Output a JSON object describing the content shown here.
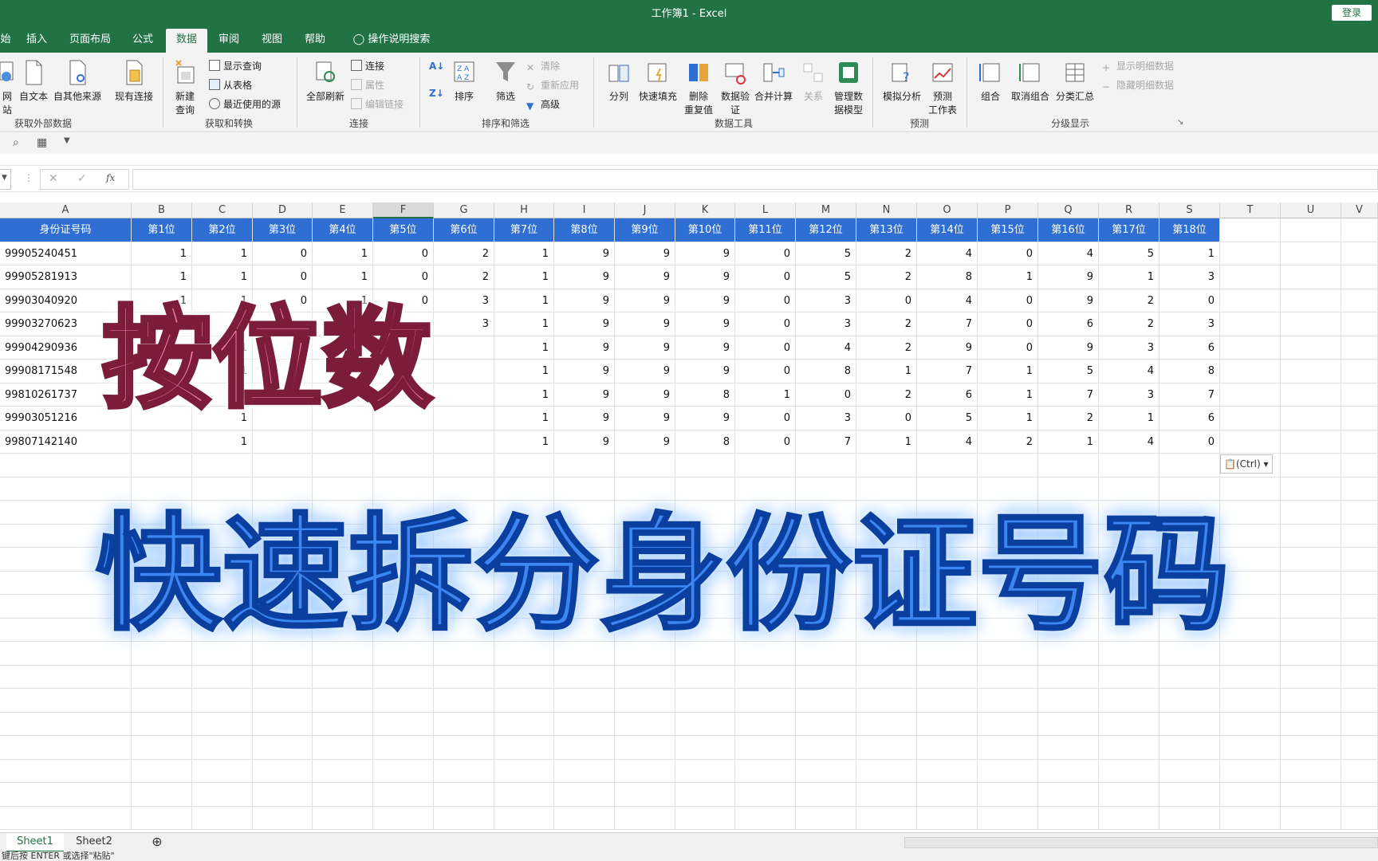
{
  "window": {
    "title": "工作簿1  -  Excel",
    "login_label": "登录"
  },
  "tabs": [
    {
      "label": "始"
    },
    {
      "label": "插入"
    },
    {
      "label": "页面布局"
    },
    {
      "label": "公式"
    },
    {
      "label": "数据",
      "active": true
    },
    {
      "label": "审阅"
    },
    {
      "label": "视图"
    },
    {
      "label": "帮助"
    },
    {
      "label": "操作说明搜索"
    }
  ],
  "ribbon": {
    "groups": {
      "get_external": "获取外部数据",
      "get_transform": "获取和转换",
      "connections": "连接",
      "sort_filter": "排序和筛选",
      "data_tools": "数据工具",
      "forecast": "预测",
      "outline": "分级显示"
    },
    "buttons": {
      "from_web": "网站",
      "from_text": "自文本",
      "from_other": "自其他来源",
      "existing_conn": "现有连接",
      "new_query_1": "新建",
      "new_query_2": "查询",
      "show_queries": "显示查询",
      "from_table": "从表格",
      "recent_sources": "最近使用的源",
      "refresh_all": "全部刷新",
      "connections": "连接",
      "properties": "属性",
      "edit_links": "编辑链接",
      "sort": "排序",
      "filter": "筛选",
      "clear": "清除",
      "reapply": "重新应用",
      "advanced": "高级",
      "text_to_columns": "分列",
      "flash_fill": "快速填充",
      "remove_dup_1": "删除",
      "remove_dup_2": "重复值",
      "validation_1": "数据验",
      "validation_2": "证",
      "consolidate": "合并计算",
      "relationships": "关系",
      "data_model_1": "管理数",
      "data_model_2": "据模型",
      "what_if": "模拟分析",
      "forecast_1": "预测",
      "forecast_2": "工作表",
      "group": "组合",
      "ungroup": "取消组合",
      "subtotal": "分类汇总",
      "show_detail": "显示明细数据",
      "hide_detail": "隐藏明细数据"
    }
  },
  "formula_bar": {
    "fx": "fx",
    "value": ""
  },
  "sheet": {
    "columns": [
      "A",
      "B",
      "C",
      "D",
      "E",
      "F",
      "G",
      "H",
      "I",
      "J",
      "K",
      "L",
      "M",
      "N",
      "O",
      "P",
      "Q",
      "R",
      "S",
      "T",
      "U",
      "V"
    ],
    "header_row": [
      "身份证号码",
      "第1位",
      "第2位",
      "第3位",
      "第4位",
      "第5位",
      "第6位",
      "第7位",
      "第8位",
      "第9位",
      "第10位",
      "第11位",
      "第12位",
      "第13位",
      "第14位",
      "第15位",
      "第16位",
      "第17位",
      "第18位"
    ],
    "rows": [
      [
        "99905240451",
        "1",
        "1",
        "0",
        "1",
        "0",
        "2",
        "1",
        "9",
        "9",
        "9",
        "0",
        "5",
        "2",
        "4",
        "0",
        "4",
        "5",
        "1"
      ],
      [
        "99905281913",
        "1",
        "1",
        "0",
        "1",
        "0",
        "2",
        "1",
        "9",
        "9",
        "9",
        "0",
        "5",
        "2",
        "8",
        "1",
        "9",
        "1",
        "3"
      ],
      [
        "99903040920",
        "1",
        "1",
        "0",
        "1",
        "0",
        "3",
        "1",
        "9",
        "9",
        "9",
        "0",
        "3",
        "0",
        "4",
        "0",
        "9",
        "2",
        "0"
      ],
      [
        "99903270623",
        "",
        "1",
        "",
        "1",
        "",
        "3",
        "1",
        "9",
        "9",
        "9",
        "0",
        "3",
        "2",
        "7",
        "0",
        "6",
        "2",
        "3"
      ],
      [
        "99904290936",
        "",
        "1",
        "",
        "",
        "",
        "",
        "1",
        "9",
        "9",
        "9",
        "0",
        "4",
        "2",
        "9",
        "0",
        "9",
        "3",
        "6"
      ],
      [
        "99908171548",
        "",
        "1",
        "",
        "",
        "",
        "",
        "1",
        "9",
        "9",
        "9",
        "0",
        "8",
        "1",
        "7",
        "1",
        "5",
        "4",
        "8"
      ],
      [
        "99810261737",
        "",
        "1",
        "",
        "1",
        "",
        "",
        "1",
        "9",
        "9",
        "8",
        "1",
        "0",
        "2",
        "6",
        "1",
        "7",
        "3",
        "7"
      ],
      [
        "99903051216",
        "",
        "1",
        "",
        "",
        "",
        "",
        "1",
        "9",
        "9",
        "9",
        "0",
        "3",
        "0",
        "5",
        "1",
        "2",
        "1",
        "6"
      ],
      [
        "99807142140",
        "",
        "1",
        "",
        "",
        "",
        "",
        "1",
        "9",
        "9",
        "8",
        "0",
        "7",
        "1",
        "4",
        "2",
        "1",
        "4",
        "0"
      ]
    ],
    "paste_tag": "(Ctrl)"
  },
  "overlay": {
    "line1": "按位数",
    "line2": "快速拆分身份证号码"
  },
  "sheet_tabs": [
    {
      "label": "Sheet1",
      "active": true
    },
    {
      "label": "Sheet2"
    }
  ],
  "status": {
    "text": "键后按 ENTER 或选择\"粘贴\""
  },
  "colors": {
    "excel_green": "#217346",
    "header_fill": "#2f6fd3",
    "overlay_pink": "#f27ba8",
    "overlay_blue": "#3c86f2"
  }
}
